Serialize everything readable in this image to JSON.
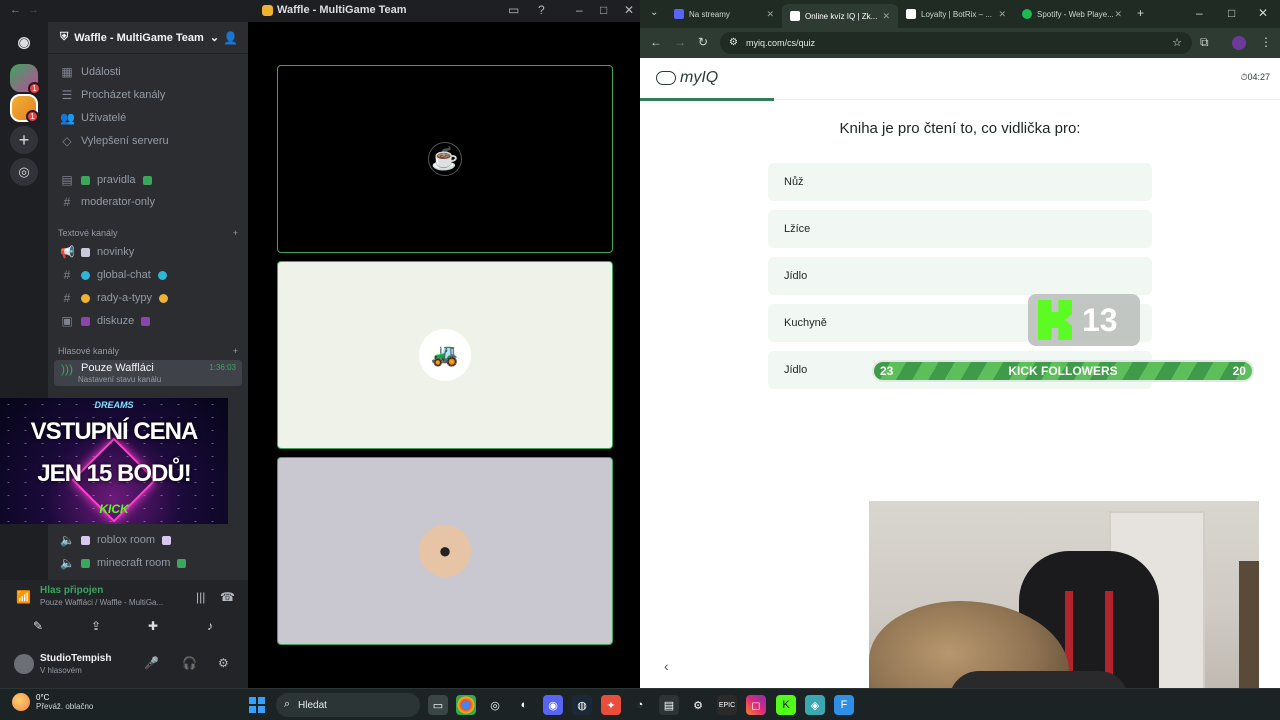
{
  "discord": {
    "window_title": "Waffle - MultiGame Team",
    "server_name": "Waffle - MultiGame Team",
    "rail_badges": {
      "s1": "1",
      "s2": "1"
    },
    "menu": [
      {
        "label": "Události",
        "icon": "calendar-icon"
      },
      {
        "label": "Procházet kanály",
        "icon": "browse-icon"
      },
      {
        "label": "Uživatelé",
        "icon": "members-icon"
      },
      {
        "label": "Vylepšení serveru",
        "icon": "boost-icon"
      }
    ],
    "pinned": [
      {
        "label": "pravidla",
        "icon": "rules-icon"
      },
      {
        "label": "moderator-only",
        "icon": "hashtag-icon"
      }
    ],
    "text_category": "Textové kanály",
    "text_channels": [
      {
        "label": "novinky",
        "icon": "announcement-icon"
      },
      {
        "label": "global-chat",
        "icon": "hashtag-icon"
      },
      {
        "label": "rady-a-typy",
        "icon": "hashtag-icon"
      },
      {
        "label": "diskuze",
        "icon": "forum-icon"
      }
    ],
    "voice_category": "Hlasové kanály",
    "active_voice": {
      "label": "Pouze Waffláci",
      "sub": "Nastavení stavu kanálu",
      "time": "1:36:03"
    },
    "voice_channels": [
      {
        "label": "roblox room"
      },
      {
        "label": "minecraft room"
      }
    ],
    "promo": {
      "top": "DREAMS",
      "line1": "VSTUPNÍ CENA",
      "line2": "JEN 15 BODŮ!",
      "bottom": "KICK"
    },
    "voice_bar": {
      "status": "Hlas připojen",
      "sub": "Pouze Waffláci / Waffle - MultiGa..."
    },
    "user": {
      "name": "StudioTempish",
      "status": "V hlasovém"
    }
  },
  "browser": {
    "tabs": [
      {
        "label": "Na streamy",
        "color": "#5865f2"
      },
      {
        "label": "Online kvíz IQ | Zk...",
        "color": "#ffffff"
      },
      {
        "label": "Loyalty | BotRix – ...",
        "color": "#ffffff"
      },
      {
        "label": "Spotify - Web Playe...",
        "color": "#1db954"
      }
    ],
    "url": "myiq.com/cs/quiz",
    "logo": "myIQ",
    "timer": "04:27",
    "progress_fraction": 0.21,
    "question": "Kniha je pro čtení to, co vidlička pro:",
    "answers": [
      "Nůž",
      "Lžíce",
      "Jídlo",
      "Kuchyně",
      "Jídlo"
    ],
    "kick_count": "13",
    "kick_bar": {
      "left": "23",
      "label": "KICK FOLLOWERS",
      "right": "20"
    }
  },
  "taskbar": {
    "weather_temp": "0°C",
    "weather_text": "Převáž. oblačno",
    "search_label": "Hledat"
  }
}
